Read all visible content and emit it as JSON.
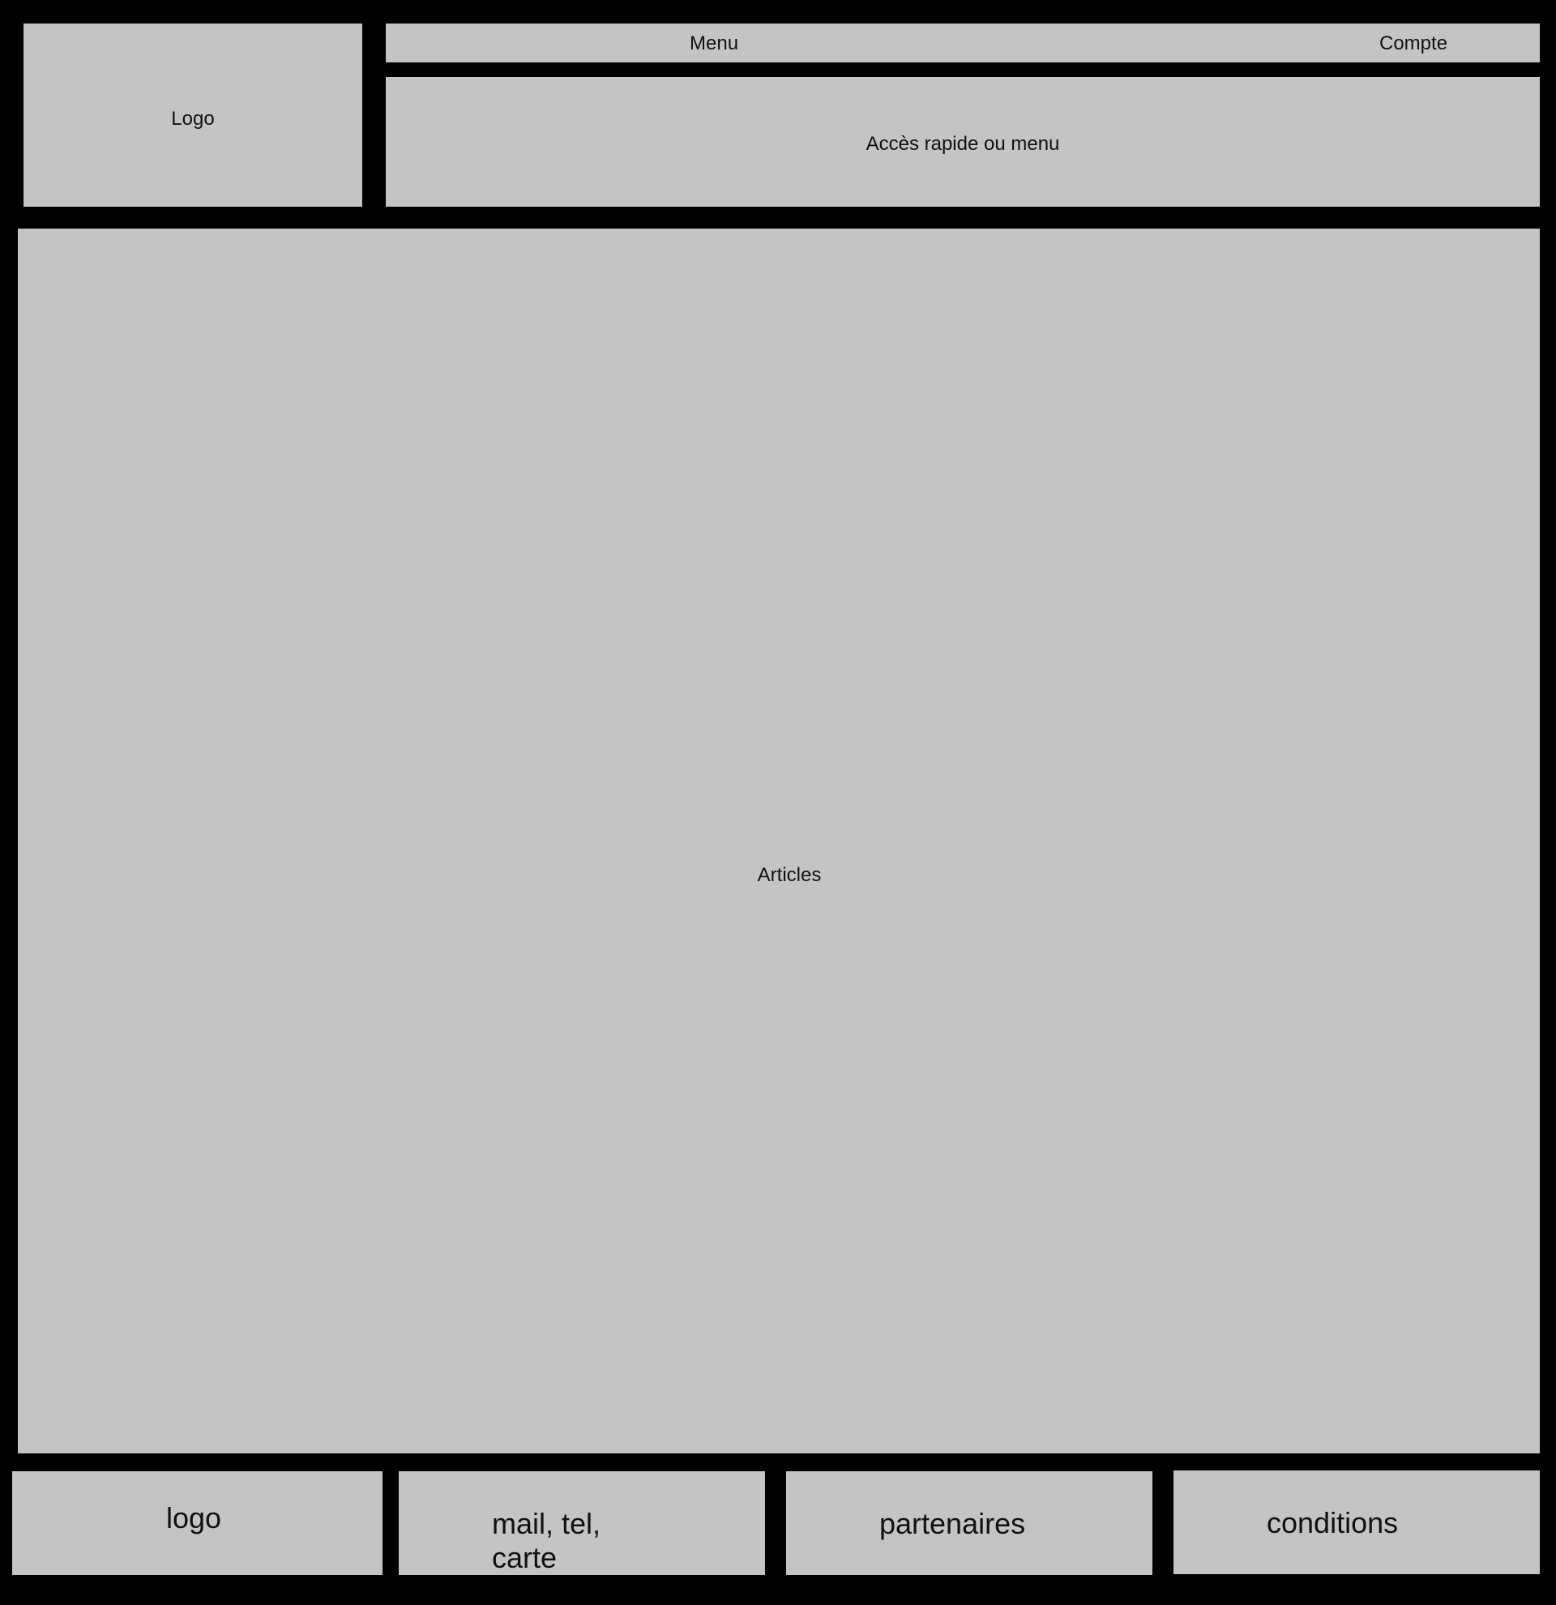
{
  "header": {
    "logo_label": "Logo",
    "menu_label": "Menu",
    "account_label": "Compte",
    "quick_access_label": "Accès rapide ou menu"
  },
  "main": {
    "articles_label": "Articles"
  },
  "footer": {
    "logo_label": "logo",
    "contact_label": "mail, tel, carte",
    "partners_label": "partenaires",
    "conditions_label": "conditions"
  },
  "colors": {
    "background": "#000000",
    "panel": "#c4c4c4",
    "text": "#111111"
  }
}
